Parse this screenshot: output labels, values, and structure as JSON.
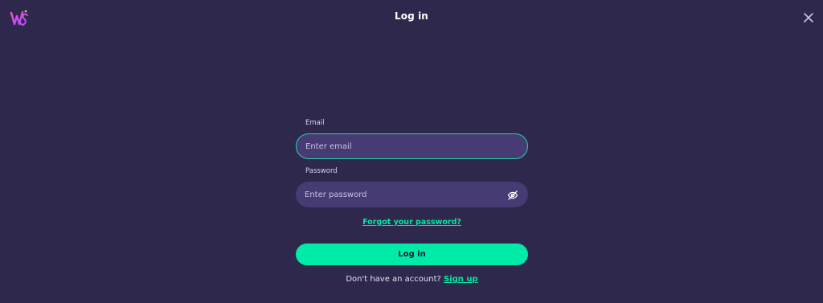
{
  "header": {
    "logo_text": "WS",
    "title": "Log in",
    "close_icon": "close-icon"
  },
  "form": {
    "email": {
      "label": "Email",
      "placeholder": "Enter email",
      "value": ""
    },
    "password": {
      "label": "Password",
      "placeholder": "Enter password",
      "value": "",
      "toggle_icon": "eye-off-icon"
    },
    "forgot_link": "Forgot your password?",
    "submit_label": "Log in",
    "signup_prompt": "Don't have an account?",
    "signup_link": "Sign up"
  },
  "colors": {
    "background": "#2e284c",
    "input_bg": "#463b72",
    "accent": "#00eba8",
    "focus_border": "#2bd3a6"
  }
}
